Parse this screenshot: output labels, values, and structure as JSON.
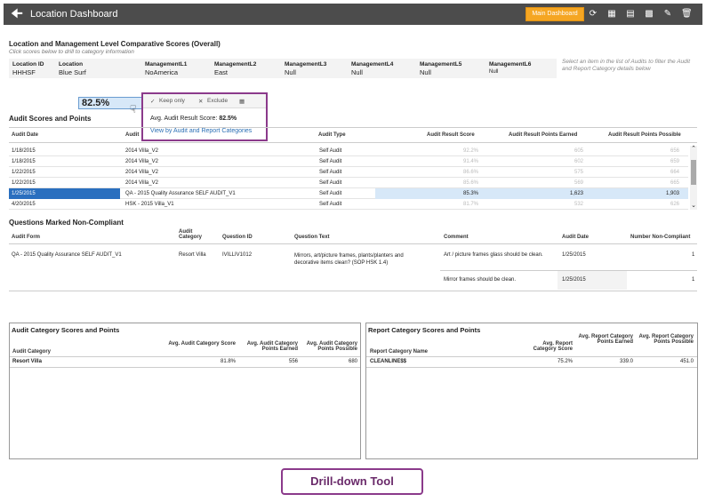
{
  "header": {
    "title": "Location Dashboard",
    "main_button": "Main Dashboard"
  },
  "comparative": {
    "title": "Location and Management Level Comparative Scores (Overall)",
    "subtitle": "Click scores below to drill to category information",
    "hint": "Select an item in the list of Audits to filter the Audit and Report Category details below",
    "columns": [
      "Location ID",
      "Location",
      "ManagementL1",
      "ManagementL2",
      "ManagementL3",
      "ManagementL4",
      "ManagementL5",
      "ManagementL6"
    ],
    "values": [
      "HHHSF",
      "Blue Surf",
      "NoAmerica",
      "East",
      "Null",
      "Null",
      "Null",
      "Null"
    ],
    "score": "82.5%"
  },
  "popup": {
    "keep_only": "Keep only",
    "exclude": "Exclude",
    "avg_label": "Avg. Audit Result Score:",
    "avg_value": "82.5%",
    "link": "View by Audit and Report Categories"
  },
  "audits": {
    "title": "Audit Scores and Points",
    "columns": [
      "Audit Date",
      "Audit",
      "Audit Type",
      "Audit Result Score",
      "Audit Result Points Earned",
      "Audit Result Points Possible"
    ],
    "rows": [
      {
        "date": "1/18/2015",
        "audit": "2014 Villa_V2",
        "type": "Self Audit",
        "score": "92.2%",
        "earned": "605",
        "possible": "656"
      },
      {
        "date": "1/18/2015",
        "audit": "2014 Villa_V2",
        "type": "Self Audit",
        "score": "91.4%",
        "earned": "602",
        "possible": "659"
      },
      {
        "date": "1/22/2015",
        "audit": "2014 Villa_V2",
        "type": "Self Audit",
        "score": "86.6%",
        "earned": "575",
        "possible": "664"
      },
      {
        "date": "1/22/2015",
        "audit": "2014 Villa_V2",
        "type": "Self Audit",
        "score": "85.6%",
        "earned": "569",
        "possible": "665"
      },
      {
        "date": "1/25/2015",
        "audit": "QA - 2015 Quality Assurance SELF AUDIT_V1",
        "type": "Self Audit",
        "score": "85.3%",
        "earned": "1,623",
        "possible": "1,903"
      },
      {
        "date": "4/20/2015",
        "audit": "HSK - 2015 Villa_V1",
        "type": "Self Audit",
        "score": "81.7%",
        "earned": "532",
        "possible": "626"
      }
    ]
  },
  "noncompliant": {
    "title": "Questions Marked Non-Compliant",
    "columns": [
      "Audit Form",
      "Audit Category",
      "Question ID",
      "Question Text",
      "Comment",
      "Audit Date",
      "Number Non-Compliant"
    ],
    "rows": [
      {
        "form": "QA - 2015 Quality Assurance SELF AUDIT_V1",
        "category": "Resort Villa",
        "qid": "IVILLIV1012",
        "text": "Mirrors, art/picture frames, plants/planters and decorative items clean? (SOP HSK 1.4)",
        "comment": "Art / picture frames glass should be clean.",
        "date": "1/25/2015",
        "count": "1"
      },
      {
        "comment": "Mirror frames should be clean.",
        "date": "1/25/2015",
        "count": "1"
      }
    ]
  },
  "audit_category": {
    "title": "Audit Category Scores and Points",
    "columns": [
      "Audit Category",
      "Avg. Audit Category Score",
      "Avg. Audit Category Points Earned",
      "Avg. Audit Category Points Possible"
    ],
    "row": {
      "name": "Resort Villa",
      "score": "81.8%",
      "earned": "556",
      "possible": "680"
    }
  },
  "report_category": {
    "title": "Report Category Scores and Points",
    "columns": [
      "Report Category Name",
      "Avg. Report Category Score",
      "Avg. Report Category Points Earned",
      "Avg. Report Category Points Possible"
    ],
    "row": {
      "name": "CLEANLINE$$",
      "score": "75.2%",
      "earned": "339.0",
      "possible": "451.0"
    }
  },
  "callout": "Drill-down Tool"
}
